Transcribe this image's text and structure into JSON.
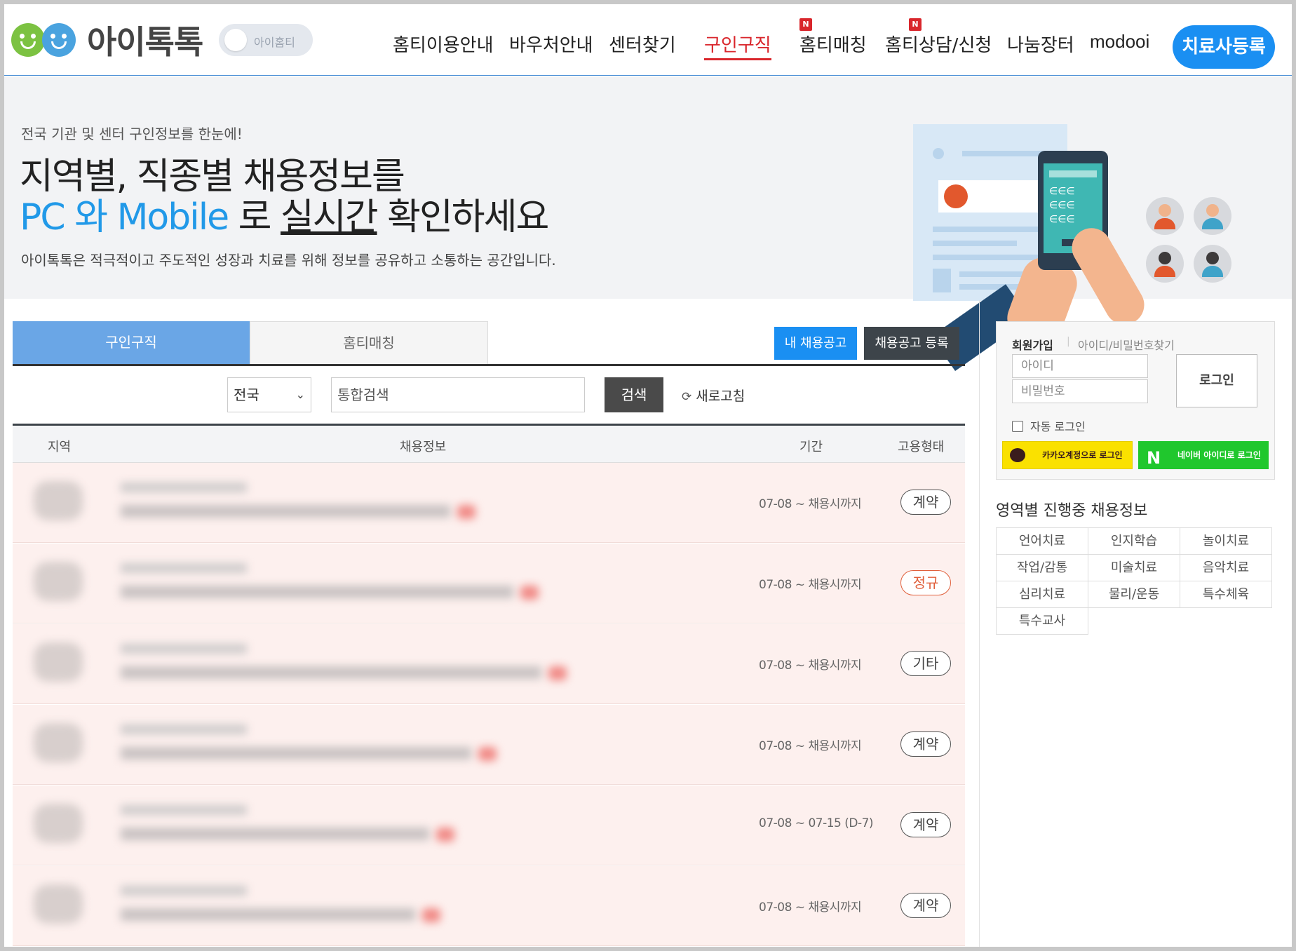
{
  "header": {
    "logo_text": "아이톡톡",
    "toggle_label": "아이홈티",
    "nav": [
      {
        "label": "홈티이용안내",
        "new": false,
        "active": false
      },
      {
        "label": "바우처안내",
        "new": false,
        "active": false
      },
      {
        "label": "센터찾기",
        "new": false,
        "active": false
      },
      {
        "label": "구인구직",
        "new": false,
        "active": true
      },
      {
        "label": "홈티매칭",
        "new": true,
        "active": false
      },
      {
        "label": "홈티상담/신청",
        "new": true,
        "active": false
      },
      {
        "label": "나눔장터",
        "new": false,
        "active": false
      },
      {
        "label": "modooi",
        "new": false,
        "active": false
      }
    ],
    "new_badge": "N",
    "register_button": "치료사등록"
  },
  "banner": {
    "subtitle": "전국 기관 및 센터 구인정보를 한눈에!",
    "headline_1": "지역별, 직종별 채용정보를",
    "headline_2_blue": "PC 와 Mobile",
    "headline_2_mid": " 로 ",
    "headline_2_underline": "실시간",
    "headline_2_end": " 확인하세요",
    "description": "아이톡톡은 적극적이고 주도적인 성장과 치료를 위해 정보를 공유하고 소통하는 공간입니다."
  },
  "tabs": {
    "job": "구인구직",
    "matching": "홈티매칭",
    "my_posts": "내 채용공고",
    "post_job": "채용공고 등록"
  },
  "search": {
    "region": "전국",
    "placeholder": "통합검색",
    "button": "검색",
    "refresh": "새로고침"
  },
  "table": {
    "headers": {
      "region": "지역",
      "info": "채용정보",
      "period": "기간",
      "type": "고용형태"
    },
    "rows": [
      {
        "period": "07-08 ~ 채용시까지",
        "type": "계약",
        "type_color": "#444444"
      },
      {
        "period": "07-08 ~ 채용시까지",
        "type": "정규",
        "type_color": "#e0603c"
      },
      {
        "period": "07-08 ~ 채용시까지",
        "type": "기타",
        "type_color": "#444444"
      },
      {
        "period": "07-08 ~ 채용시까지",
        "type": "계약",
        "type_color": "#444444"
      },
      {
        "period": "07-08 ~ 07-15 (D-7)",
        "type": "계약",
        "type_color": "#444444"
      },
      {
        "period": "07-08 ~ 채용시까지",
        "type": "계약",
        "type_color": "#444444"
      }
    ]
  },
  "login": {
    "join": "회원가입",
    "find": "아이디/비밀번호찾기",
    "id_placeholder": "아이디",
    "pw_placeholder": "비밀번호",
    "login_button": "로그인",
    "auto_login": "자동 로그인",
    "kakao": "카카오계정으로 로그인",
    "naver": "네이버 아이디로 로그인"
  },
  "areas": {
    "title": "영역별 진행중 채용정보",
    "items": [
      "언어치료",
      "인지학습",
      "놀이치료",
      "작업/감통",
      "미술치료",
      "음악치료",
      "심리치료",
      "물리/운동",
      "특수체육",
      "특수교사"
    ]
  },
  "colors": {
    "accent_blue": "#1a8ff2",
    "active_red": "#d9262c",
    "tab_active": "#6aa6e6",
    "row_bg": "#fdf0ee"
  }
}
